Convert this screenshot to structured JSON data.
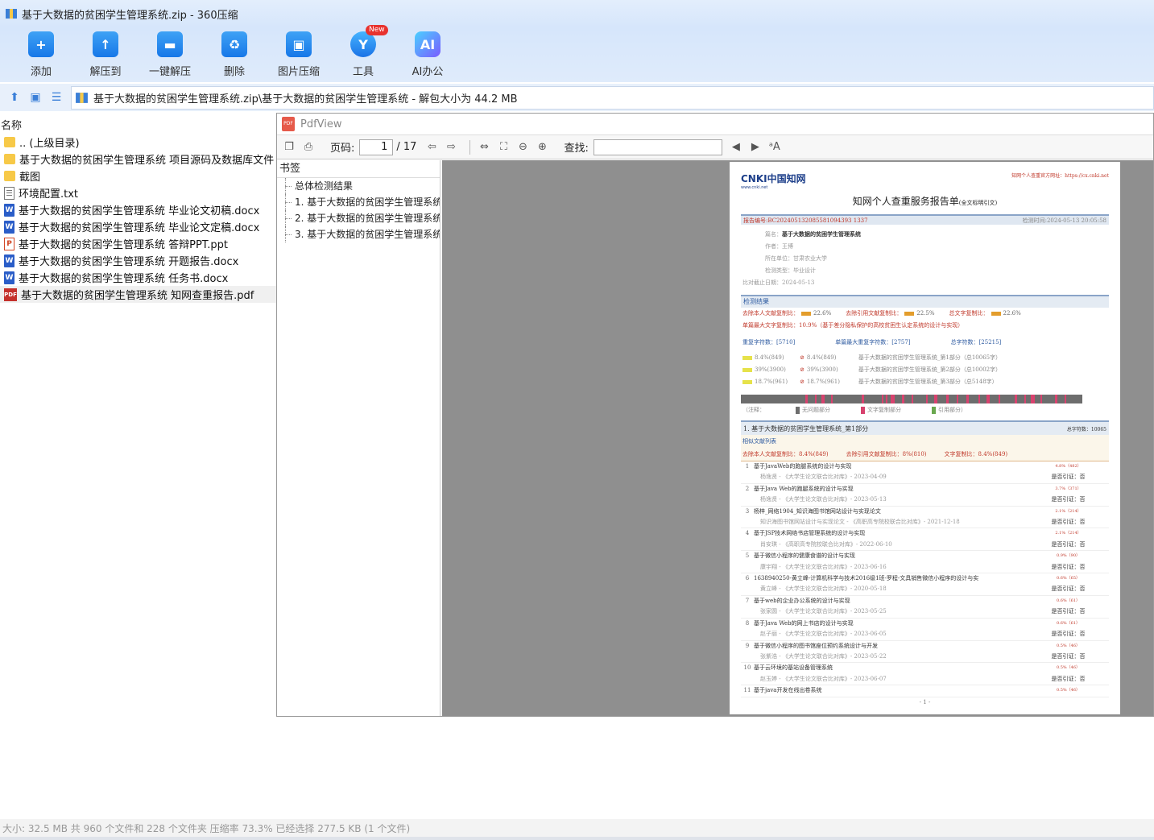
{
  "window": {
    "title": "基于大数据的贫困学生管理系统.zip - 360压缩"
  },
  "toolbar": {
    "buttons": [
      {
        "label": "添加",
        "icon": "add-icon"
      },
      {
        "label": "解压到",
        "icon": "extract-to-icon"
      },
      {
        "label": "一键解压",
        "icon": "one-click-extract-icon"
      },
      {
        "label": "删除",
        "icon": "delete-icon"
      },
      {
        "label": "图片压缩",
        "icon": "image-compress-icon"
      },
      {
        "label": "工具",
        "icon": "tools-icon",
        "badge": "New"
      },
      {
        "label": "AI办公",
        "icon": "ai-office-icon",
        "icon_text": "AI"
      }
    ]
  },
  "address": {
    "path": "基于大数据的贫困学生管理系统.zip\\基于大数据的贫困学生管理系统 - 解包大小为 44.2 MB"
  },
  "filelist": {
    "column_name": "名称",
    "items": [
      {
        "name": ".. (上级目录)",
        "type": "folder"
      },
      {
        "name": "基于大数据的贫困学生管理系统 项目源码及数据库文件",
        "type": "folder"
      },
      {
        "name": "截图",
        "type": "folder"
      },
      {
        "name": "环境配置.txt",
        "type": "txt"
      },
      {
        "name": "基于大数据的贫困学生管理系统 毕业论文初稿.docx",
        "type": "docx"
      },
      {
        "name": "基于大数据的贫困学生管理系统 毕业论文定稿.docx",
        "type": "docx"
      },
      {
        "name": "基于大数据的贫困学生管理系统 答辩PPT.ppt",
        "type": "ppt"
      },
      {
        "name": "基于大数据的贫困学生管理系统 开题报告.docx",
        "type": "docx"
      },
      {
        "name": "基于大数据的贫困学生管理系统 任务书.docx",
        "type": "docx"
      },
      {
        "name": "基于大数据的贫困学生管理系统 知网查重报告.pdf",
        "type": "pdf",
        "selected": true
      }
    ]
  },
  "pdfview": {
    "title": "PdfView",
    "page_label": "页码:",
    "page_current": "1",
    "page_total": "/ 17",
    "find_label": "查找:",
    "bookmarks_header": "书签",
    "bookmarks": [
      "总体检测结果",
      "1. 基于大数据的贫困学生管理系统",
      "2. 基于大数据的贫困学生管理系统",
      "3. 基于大数据的贫困学生管理系统"
    ]
  },
  "report": {
    "logo": "CNKI中国知网",
    "logo_sub": "www.cnki.net",
    "site": "知网个人查重官方网址：https://cx.cnki.net",
    "title": "知网个人查重服务报告单",
    "title_note": "(全文标明引文)",
    "report_no": "报告编号:BC202405132085581094393 1337",
    "check_time": "检测时间:2024-05-13 20:05:58",
    "meta": [
      {
        "k": "篇名：",
        "v": "基于大数据的贫困学生管理系统"
      },
      {
        "k": "作者：",
        "v": "王博"
      },
      {
        "k": "所在单位：",
        "v": "甘肃农业大学"
      },
      {
        "k": "检测类型：",
        "v": "毕业设计"
      },
      {
        "k": "比对截止日期：",
        "v": "2024-05-13"
      }
    ],
    "result_header": "检测结果",
    "stat1": "去除本人文献复制比：",
    "stat1_v": "22.6%",
    "stat2": "去除引用文献复制比：",
    "stat2_v": "22.5%",
    "stat3": "总文字复制比：",
    "stat3_v": "22.6%",
    "single_max": "单篇最大文字复制比：10.9%（基于差分隐私保护的高校贫困生认定系统的设计与实现）",
    "repeat_chars": "重复字符数：[5710]",
    "single_max_chars": "单篇最大重复字符数：[2757]",
    "total_chars": "总字符数：[25215]",
    "parts": [
      {
        "a": "8.4%(849)",
        "b": "8.4%(849)",
        "name": "基于大数据的贫困学生管理系统_第1部分（总10065字）"
      },
      {
        "a": "39%(3900)",
        "b": "39%(3900)",
        "name": "基于大数据的贫困学生管理系统_第2部分（总10002字）"
      },
      {
        "a": "18.7%(961)",
        "b": "18.7%(961)",
        "name": "基于大数据的贫困学生管理系统_第3部分（总5148字）"
      }
    ],
    "legend": [
      "（注释：",
      "无问题部分",
      "文字复制部分",
      "引用部分）"
    ],
    "part1_title": "1. 基于大数据的贫困学生管理系统_第1部分",
    "part1_total": "总字符数：10065",
    "sim_list": "相似文献列表",
    "sim_stat1": "去除本人文献复制比：8.4%(849)",
    "sim_stat2": "去除引用文献复制比：8%(810)",
    "sim_stat3": "文字复制比：8.4%(849)",
    "refs": [
      {
        "n": "1",
        "t": "基于JavaWeb的跑腿系统的设计与实现",
        "r": "4.8%（482）",
        "s": "杨逸贤 - 《大学生论文联合比对库》- 2023-04-09",
        "q": "是否引证：否"
      },
      {
        "n": "2",
        "t": "基于Java Web的跑腿系统的设计与实现",
        "r": "3.7%（371）",
        "s": "杨逸贤 - 《大学生论文联合比对库》- 2023-05-13",
        "q": "是否引证：否"
      },
      {
        "n": "3",
        "t": "杨梓_网络1904_知识海图书馆网站设计与实现论文",
        "r": "2.1%（214）",
        "s": "知识海图书馆网站设计与实现论文 - 《高职高专院校联合比对库》- 2021-12-18",
        "q": "是否引证：否"
      },
      {
        "n": "4",
        "t": "基于JSP技术网络书店管理系统的设计与实现",
        "r": "2.1%（214）",
        "s": "肖安琪 - 《高职高专院校联合比对库》- 2022-06-10",
        "q": "是否引证：否"
      },
      {
        "n": "5",
        "t": "基于微信小程序的健康食谱的设计与实现",
        "r": "0.9%（90）",
        "s": "康宇翔 - 《大学生论文联合比对库》- 2023-06-16",
        "q": "是否引证：否"
      },
      {
        "n": "6",
        "t": "1638940250-黄立峰-计算机科学与技术2016级1班-罗程-文具销售微信小程序的设计与实",
        "r": "0.6%（65）",
        "s": "黄立峰 - 《大学生论文联合比对库》- 2020-05-18",
        "q": "是否引证：否"
      },
      {
        "n": "7",
        "t": "基于web的企业办公系统的设计与实现",
        "r": "0.6%（61）",
        "s": "张家圆 - 《大学生论文联合比对库》- 2023-05-25",
        "q": "是否引证：否"
      },
      {
        "n": "8",
        "t": "基于Java Web的网上书店的设计与实现",
        "r": "0.6%（61）",
        "s": "赵子丽 - 《大学生论文联合比对库》- 2023-06-05",
        "q": "是否引证：否"
      },
      {
        "n": "9",
        "t": "基于微信小程序的图书馆座位预约系统设计与开发",
        "r": "0.5%（46）",
        "s": "张紫浩 - 《大学生论文联合比对库》- 2023-05-22",
        "q": "是否引证：否"
      },
      {
        "n": "10",
        "t": "基于云环境的基站设备管理系统",
        "r": "0.5%（46）",
        "s": "赵玉婷 - 《大学生论文联合比对库》- 2023-06-07",
        "q": "是否引证：否"
      },
      {
        "n": "11",
        "t": "基于java开发在线出卷系统",
        "r": "0.5%（46）",
        "s": "",
        "q": ""
      }
    ],
    "page_footer": "- 1 -"
  },
  "statusbar": {
    "text": "大小: 32.5 MB 共 960 个文件和 228 个文件夹 压缩率 73.3% 已经选择 277.5 KB (1 个文件)"
  },
  "colors": {
    "accent": "#1677e8",
    "selected_row": "#f0f0f0",
    "viewer_bg": "#8f8f8f",
    "report_red": "#c0392b"
  }
}
